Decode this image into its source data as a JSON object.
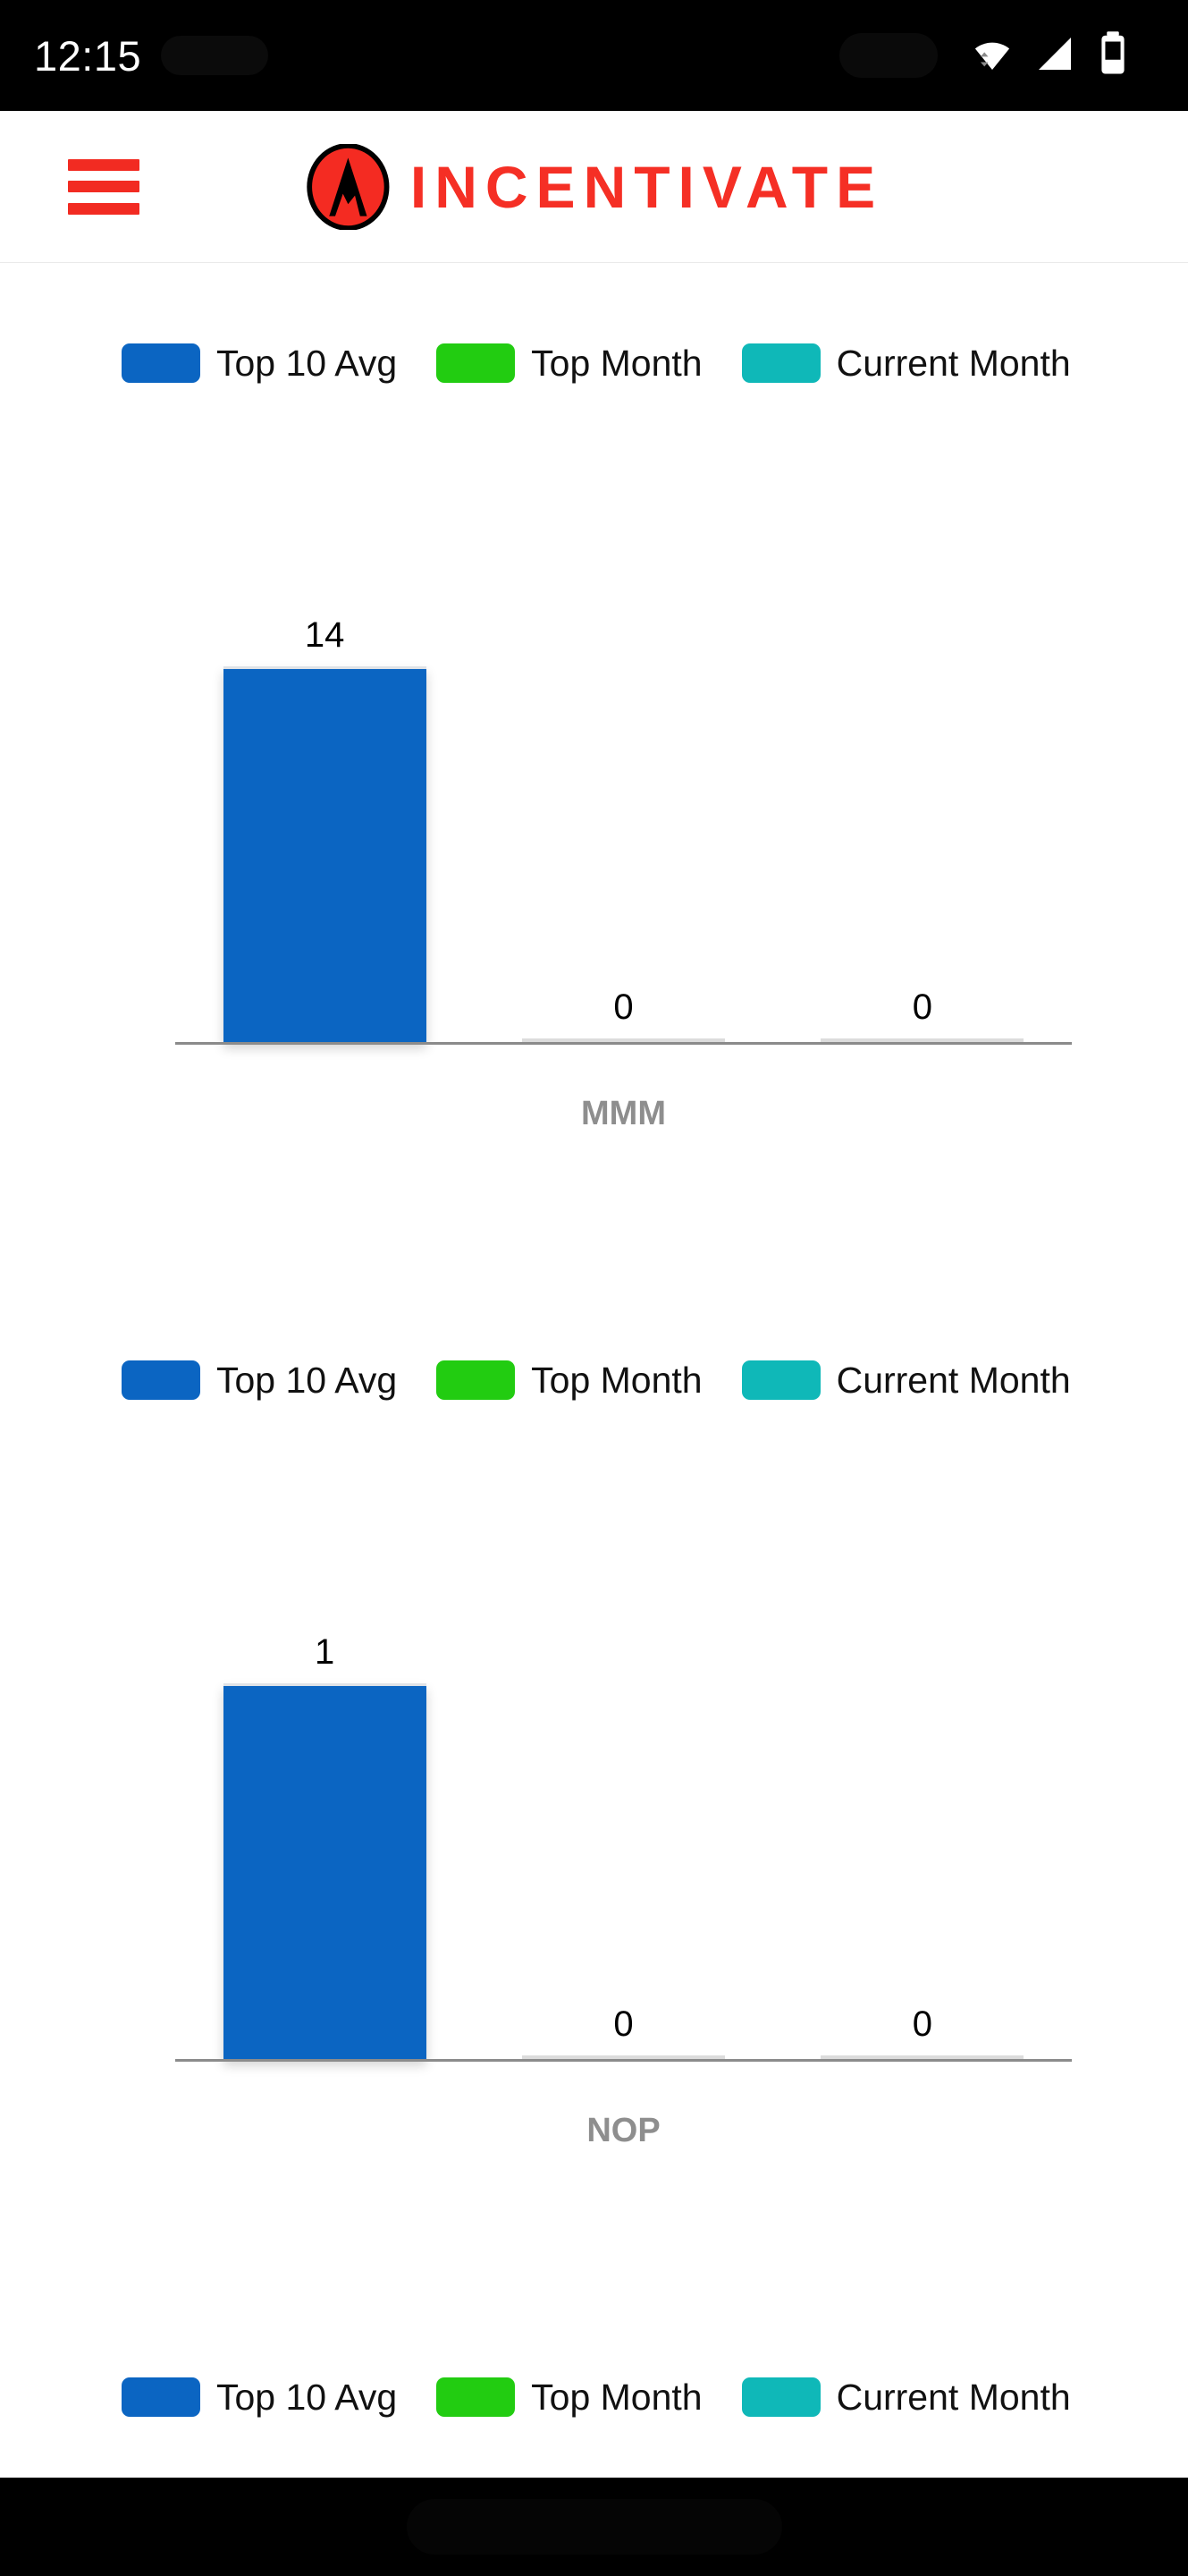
{
  "status_bar": {
    "time": "12:15",
    "icons": [
      "wifi-icon",
      "cellular-signal-icon",
      "battery-icon"
    ]
  },
  "header": {
    "menu_icon": "hamburger-menu-icon",
    "logo_icon": "incentivate-mountain-logo",
    "brand_name": "INCENTIVATE",
    "brand_color": "#f52f25"
  },
  "legend": {
    "items": [
      {
        "label": "Top 10 Avg",
        "color": "#0b65c2"
      },
      {
        "label": "Top Month",
        "color": "#22cc11"
      },
      {
        "label": "Current Month",
        "color": "#0fb8b8"
      }
    ]
  },
  "chart_data": [
    {
      "type": "bar",
      "title": "",
      "xlabel": "MMM",
      "ylabel": "",
      "categories": [
        "Top 10 Avg",
        "Top Month",
        "Current Month"
      ],
      "values": [
        14,
        0,
        0
      ],
      "data_labels": [
        "14",
        "0",
        "0"
      ],
      "colors": [
        "#0b65c2",
        "#22cc11",
        "#0fb8b8"
      ],
      "legend": [
        "Top 10 Avg",
        "Top Month",
        "Current Month"
      ],
      "legend_position": "top-left",
      "grid": false,
      "ylim": [
        0,
        16
      ]
    },
    {
      "type": "bar",
      "title": "",
      "xlabel": "NOP",
      "ylabel": "",
      "categories": [
        "Top 10 Avg",
        "Top Month",
        "Current Month"
      ],
      "values": [
        1,
        0,
        0
      ],
      "data_labels": [
        "1",
        "0",
        "0"
      ],
      "colors": [
        "#0b65c2",
        "#22cc11",
        "#0fb8b8"
      ],
      "legend": [
        "Top 10 Avg",
        "Top Month",
        "Current Month"
      ],
      "legend_position": "top-left",
      "grid": false,
      "ylim": [
        0,
        1.15
      ]
    },
    {
      "type": "bar",
      "title": "",
      "xlabel": "",
      "ylabel": "",
      "categories": [
        "Top 10 Avg",
        "Top Month",
        "Current Month"
      ],
      "values": [],
      "data_labels": [],
      "colors": [
        "#0b65c2",
        "#22cc11",
        "#0fb8b8"
      ],
      "legend": [
        "Top 10 Avg",
        "Top Month",
        "Current Month"
      ],
      "legend_position": "top-left",
      "grid": false
    }
  ]
}
